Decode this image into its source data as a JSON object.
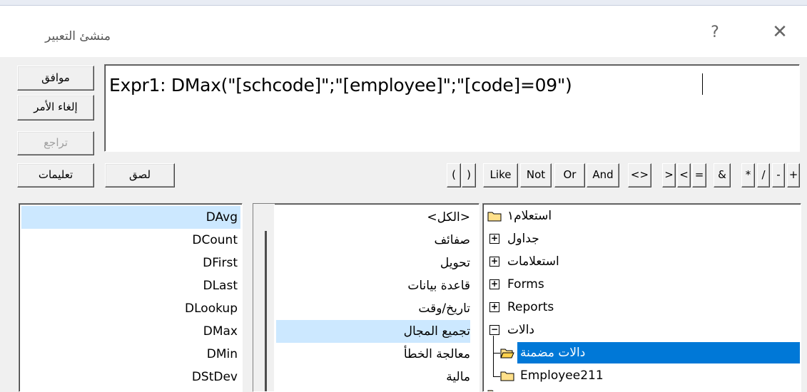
{
  "window": {
    "title": "منشئ التعبير",
    "help_glyph": "?",
    "close_glyph": "✕"
  },
  "buttons": {
    "ok": "موافق",
    "cancel": "إلغاء الأمر",
    "undo": "تراجع",
    "help": "تعليمات",
    "paste": "لصق"
  },
  "expression": {
    "text": "Expr1: DMax(\"[schcode]\";\"[employee]\";\"[code]=09\")"
  },
  "operators": [
    "+",
    "-",
    "/",
    "*",
    "&",
    "=",
    "<",
    ">",
    "<>",
    "And",
    "Or",
    "Not",
    "Like",
    "(",
    ")"
  ],
  "functions_list": {
    "items": [
      "DAvg",
      "DCount",
      "DFirst",
      "DLast",
      "DLookup",
      "DMax",
      "DMin",
      "DStDev"
    ],
    "selected": "DAvg"
  },
  "categories_list": {
    "items": [
      "<الكل>",
      "صفائف",
      "تحويل",
      "قاعدة بيانات",
      "تاريخ/وقت",
      "تجميع المجال",
      "معالجة الخطأ",
      "مالية"
    ],
    "selected": "تجميع المجال"
  },
  "tree": {
    "nodes": [
      {
        "label": "استعلام١",
        "expander": ""
      },
      {
        "label": "جداول",
        "expander": "+"
      },
      {
        "label": "استعلامات",
        "expander": "+"
      },
      {
        "label": "Forms",
        "expander": "+"
      },
      {
        "label": "Reports",
        "expander": "+"
      },
      {
        "label": "دالات",
        "expander": "−"
      },
      {
        "label": "دالات مضمنة",
        "expander": ""
      },
      {
        "label": "Employee211",
        "expander": ""
      }
    ],
    "selected": "دالات مضمنة"
  },
  "colors": {
    "selection_light": "#cce8ff",
    "selection_dark": "#0078d7",
    "folder": "#ffe08a"
  }
}
